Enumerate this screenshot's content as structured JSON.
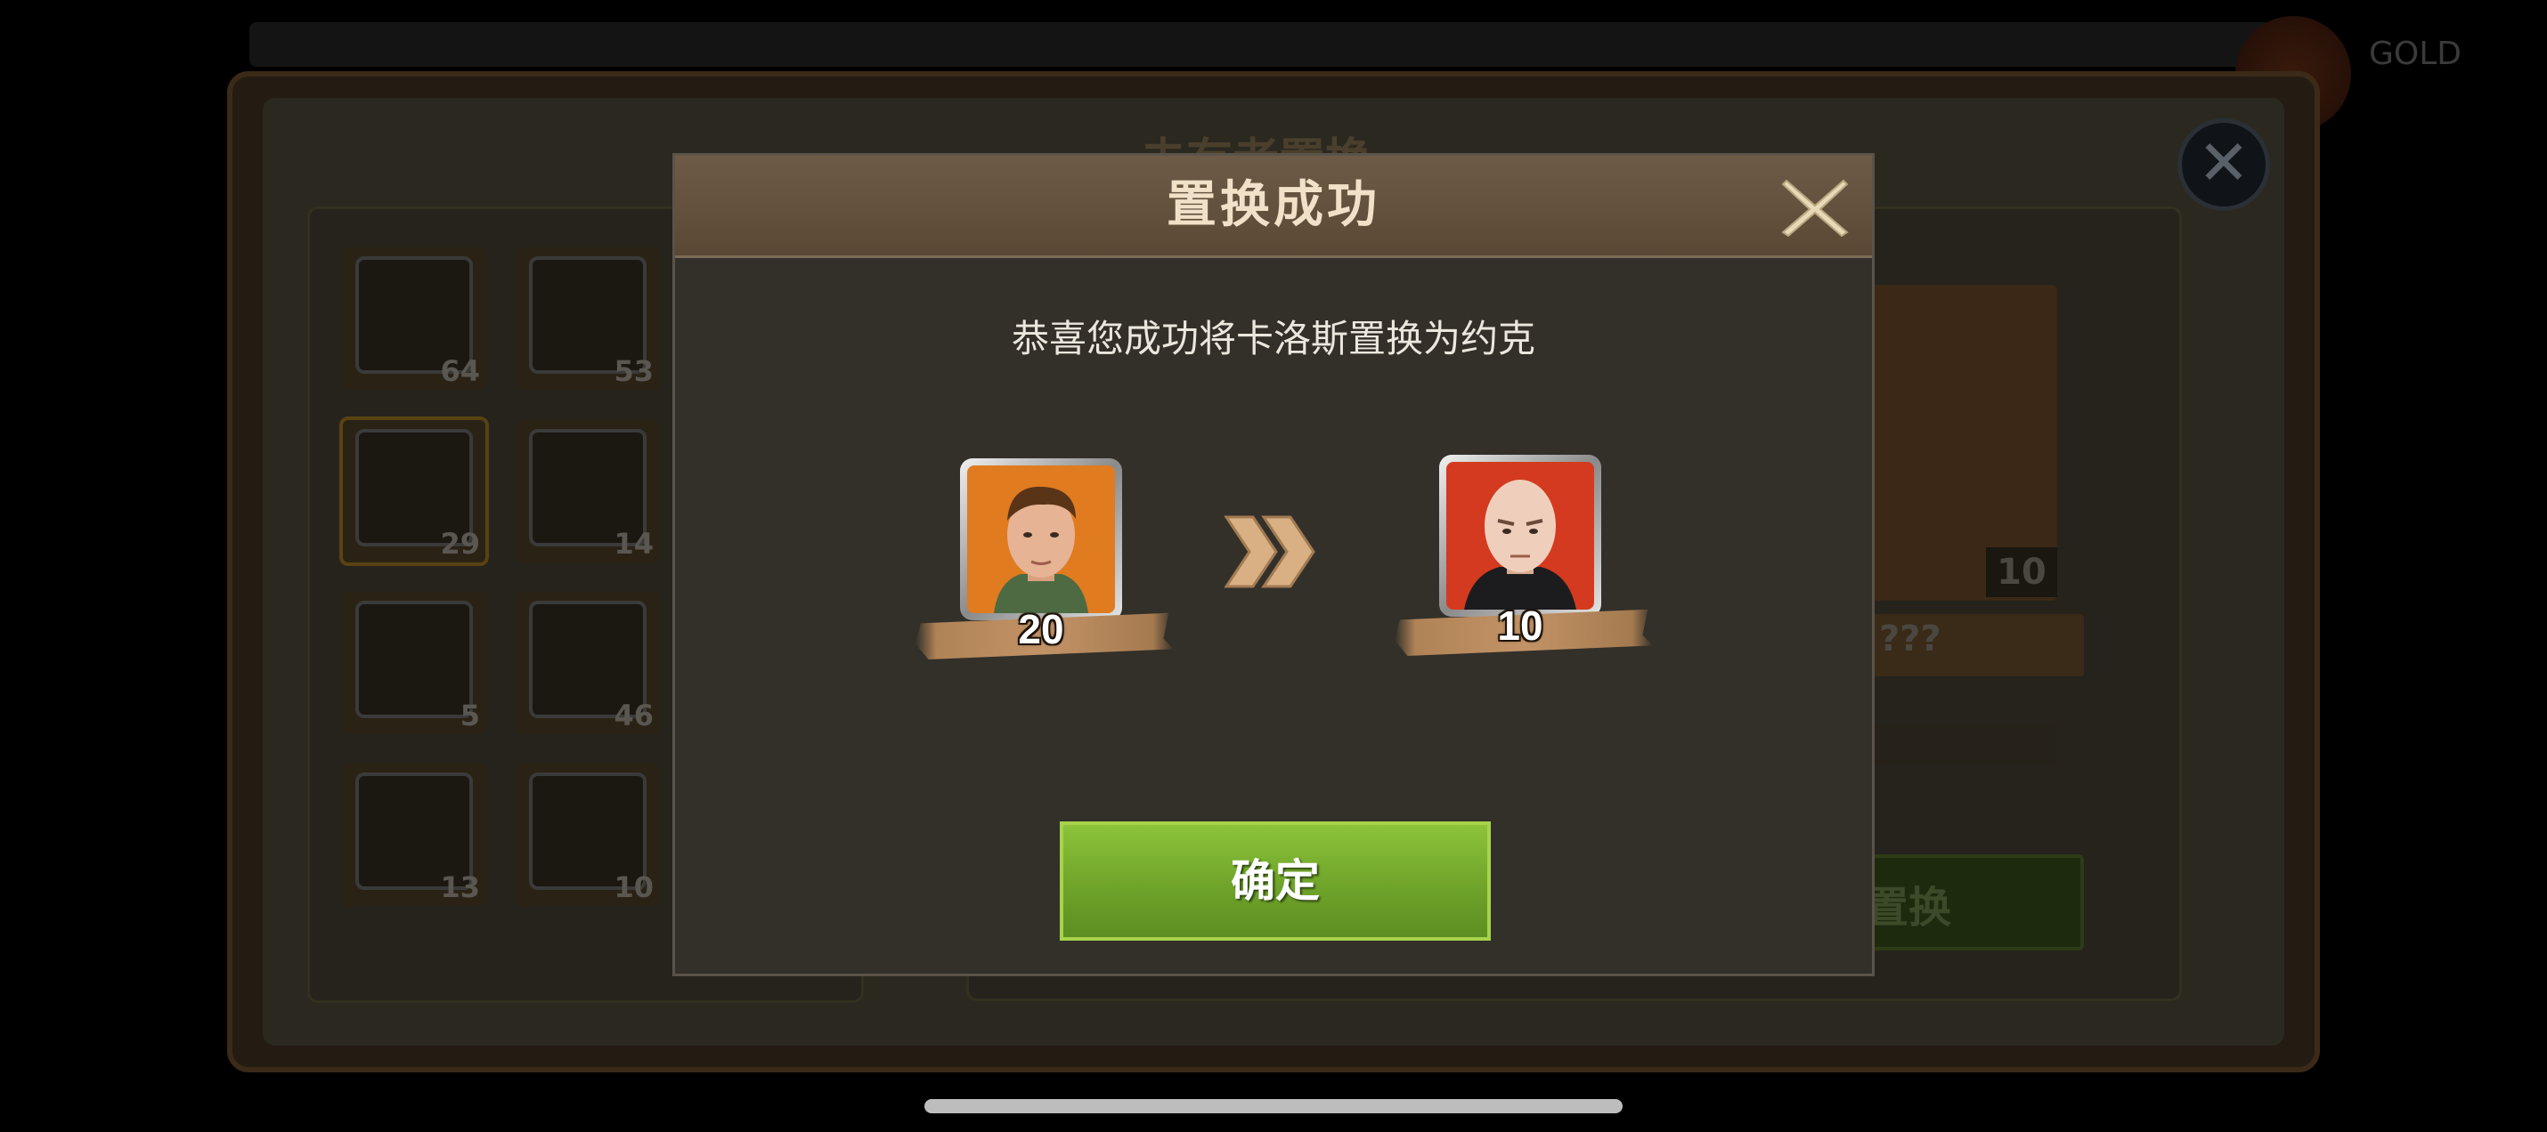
{
  "background": {
    "panel_title": "未有者置换",
    "currency_text": "GOLD",
    "hero_list": [
      {
        "level": "64"
      },
      {
        "level": "53"
      },
      {
        "level": "29"
      },
      {
        "level": "14"
      },
      {
        "level": "5"
      },
      {
        "level": "46"
      },
      {
        "level": "13"
      },
      {
        "level": "10"
      }
    ],
    "target_level": "10",
    "target_name": "???",
    "replace_button_label": "置换"
  },
  "dialog": {
    "title": "置换成功",
    "message": "恭喜您成功将卡洛斯置换为约克",
    "from_hero": {
      "level": "20",
      "bg_color": "#e07b20"
    },
    "to_hero": {
      "level": "10",
      "bg_color": "#d43a1f"
    },
    "confirm_label": "确定",
    "close_icon": "close-icon",
    "arrow_icon": "double-chevron-right-icon"
  },
  "colors": {
    "confirm_green": "#7cb432",
    "title_text": "#f1e1c8",
    "header_brown": "#6e5b47"
  }
}
